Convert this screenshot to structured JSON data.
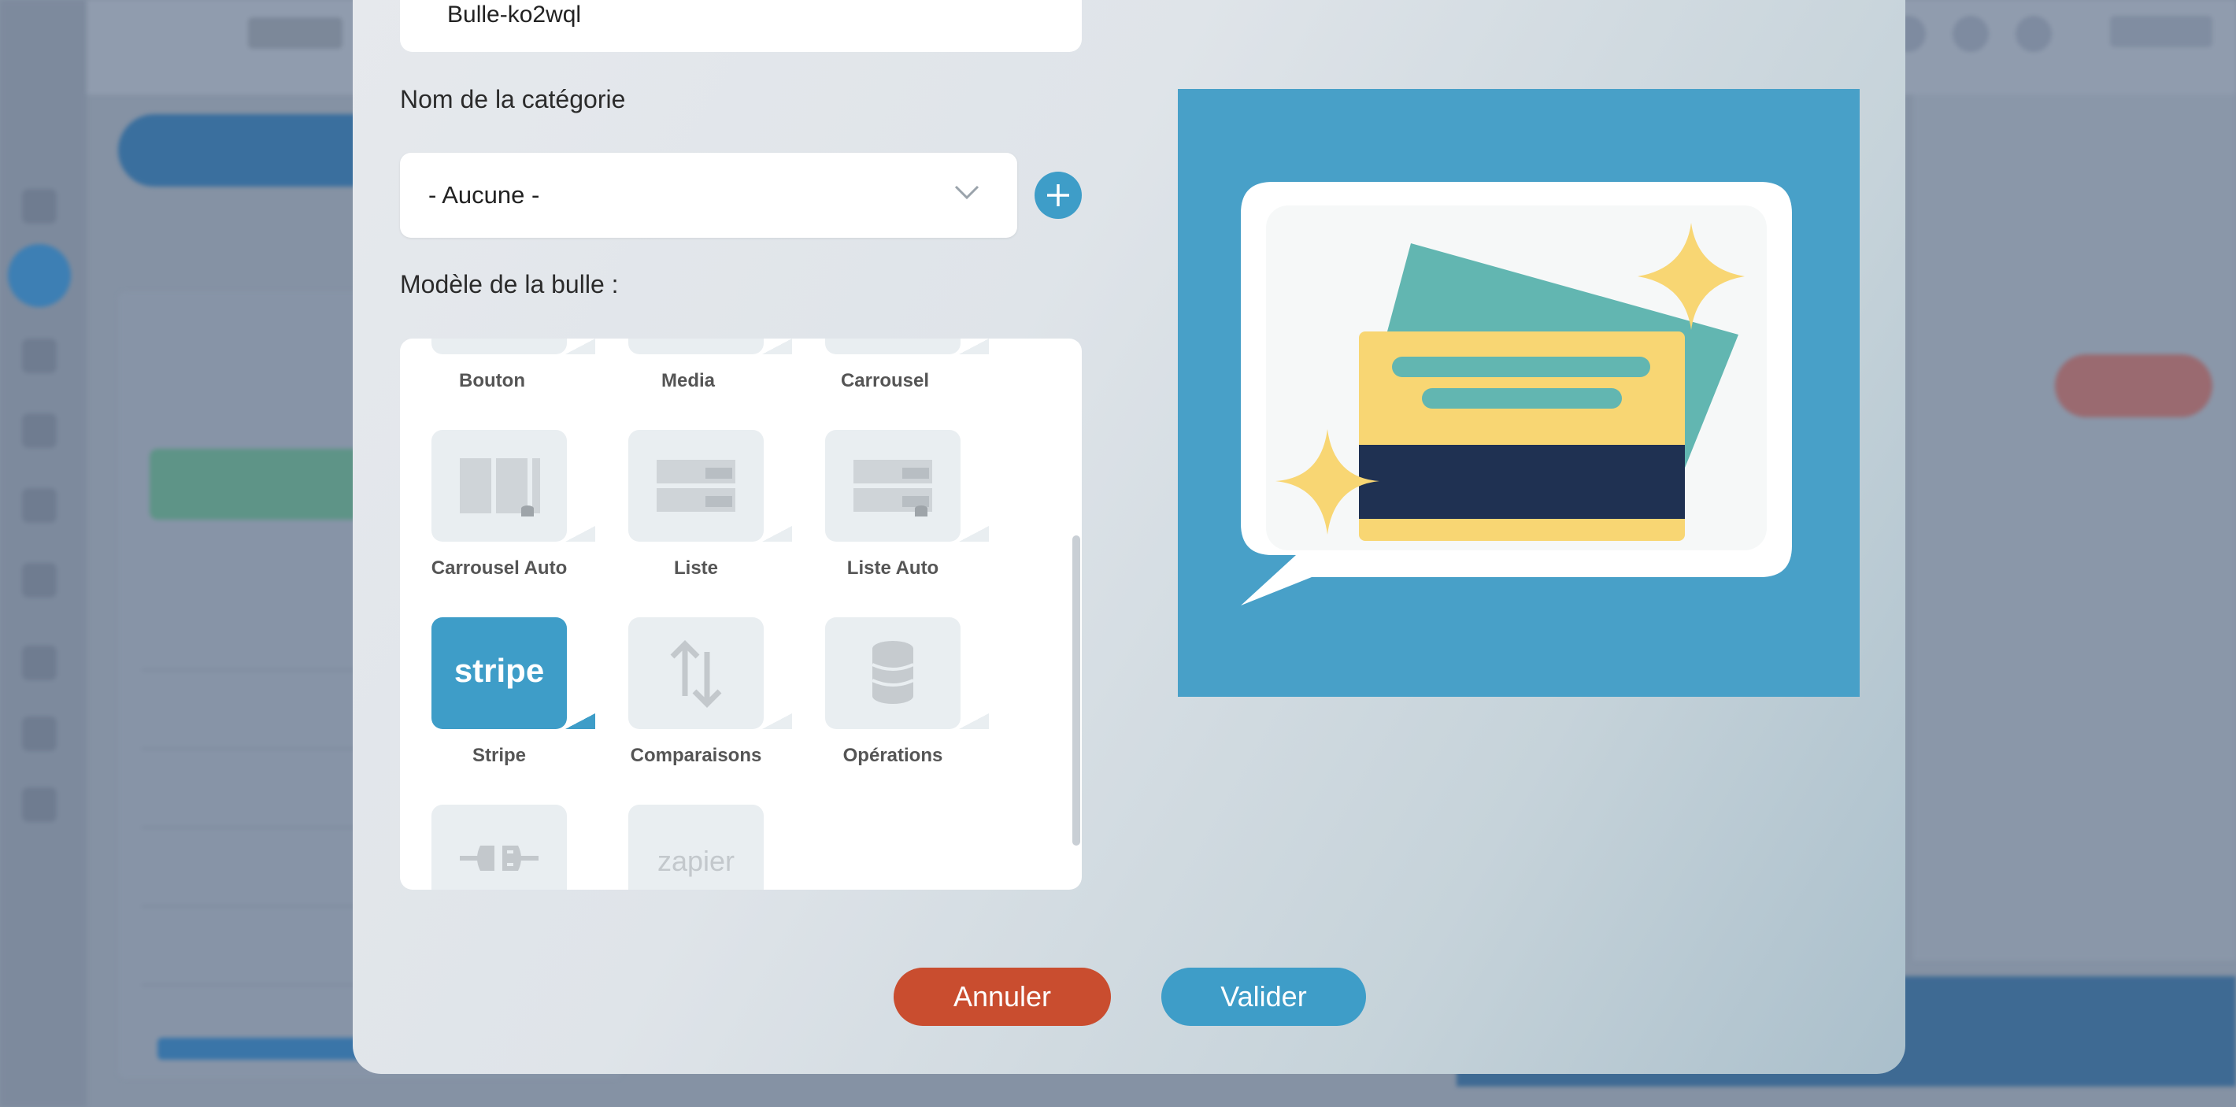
{
  "modal": {
    "name_field_value": "Bulle-ko2wql",
    "category_label": "Nom de la catégorie",
    "category_select_value": "- Aucune -",
    "template_label": "Modèle de la bulle :",
    "templates": [
      {
        "label": "Bouton"
      },
      {
        "label": "Media"
      },
      {
        "label": "Carrousel"
      },
      {
        "label": "Carrousel Auto"
      },
      {
        "label": "Liste"
      },
      {
        "label": "Liste Auto"
      },
      {
        "label": "Stripe",
        "logo_text": "stripe"
      },
      {
        "label": "Comparaisons"
      },
      {
        "label": "Opérations"
      },
      {
        "label": "Plugin"
      },
      {
        "label": "Zapier",
        "logo_text": "zapier"
      }
    ],
    "buttons": {
      "cancel": "Annuler",
      "validate": "Valider"
    }
  },
  "colors": {
    "accent": "#3e9dc8",
    "cancel": "#c94d2f",
    "preview_bg": "#48a0c8",
    "card_yellow": "#f8d673",
    "card_teal": "#62b6b1",
    "card_navy": "#1f3152"
  },
  "icons": [
    "plus-icon",
    "chevron-down-icon",
    "carousel-auto-icon",
    "list-icon",
    "list-auto-icon",
    "transfer-arrows-icon",
    "database-icon",
    "plug-icon",
    "sparkle-icon",
    "credit-card-icon"
  ]
}
